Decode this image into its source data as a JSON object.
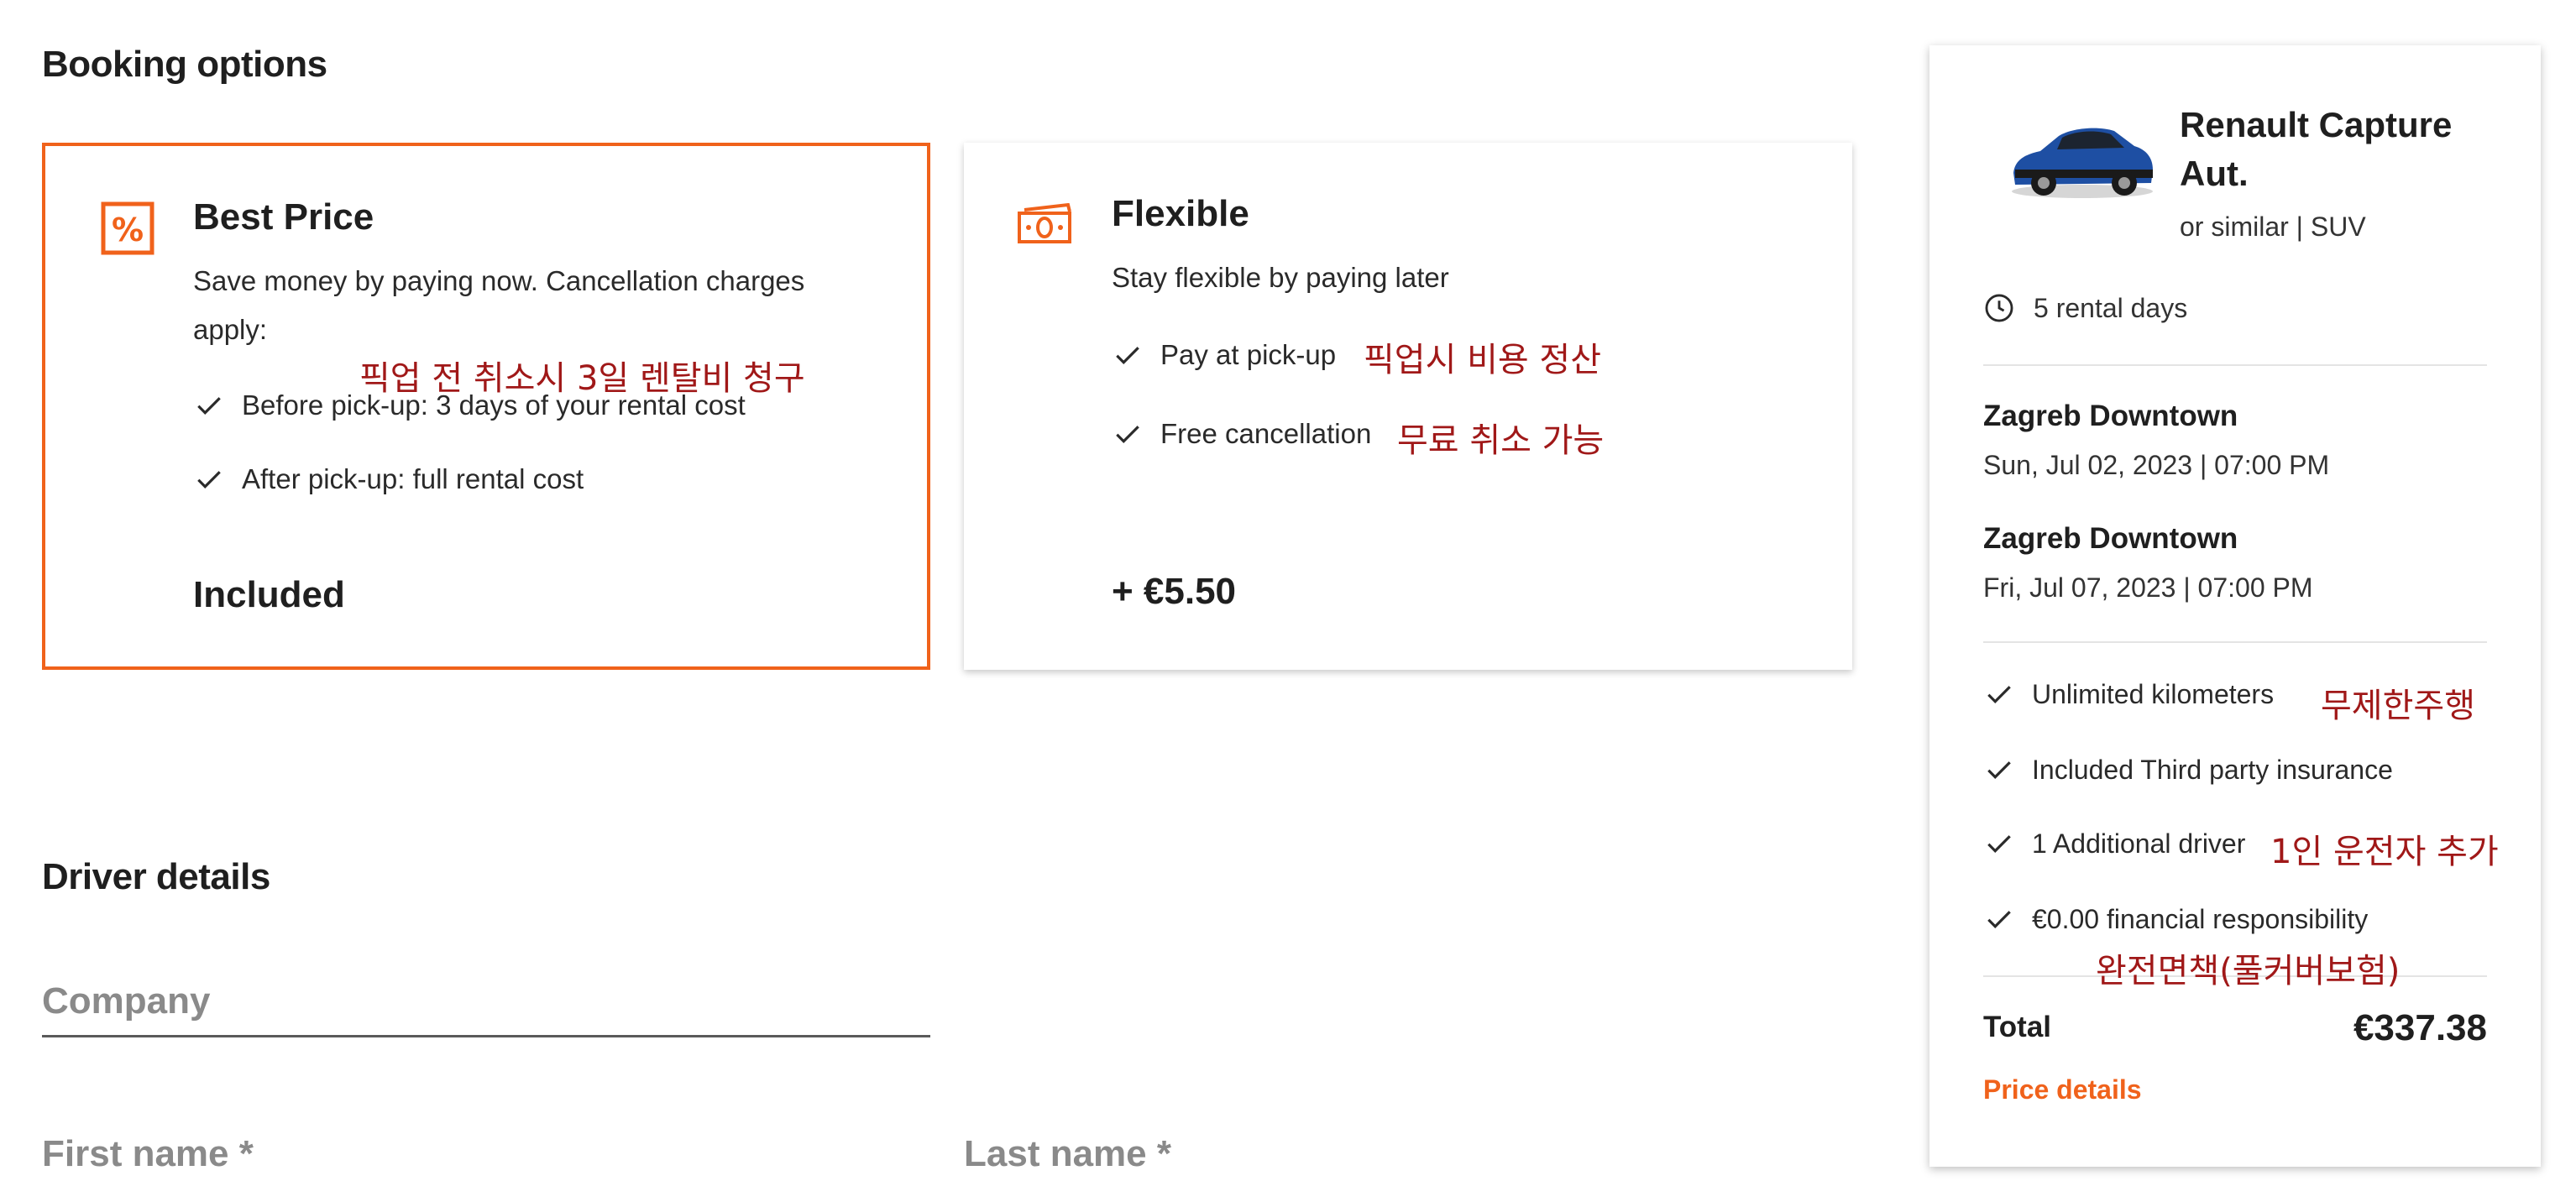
{
  "booking": {
    "heading": "Booking options",
    "best_price": {
      "title": "Best Price",
      "desc": "Save money by paying now. Cancellation charges apply:",
      "items": [
        "Before pick-up: 3 days of your rental cost",
        "After pick-up: full rental cost"
      ],
      "price": "Included",
      "icon": "percent-icon",
      "annotation": "픽업 전 취소시 3일 렌탈비 청구"
    },
    "flexible": {
      "title": "Flexible",
      "desc": "Stay flexible by paying later",
      "items": [
        "Pay at pick-up",
        "Free cancellation"
      ],
      "price": "+ €5.50",
      "icon": "cash-icon",
      "annotations": [
        "픽업시 비용 정산",
        "무료 취소 가능"
      ]
    }
  },
  "driver": {
    "heading": "Driver details",
    "company_label": "Company",
    "first_name_label": "First name *",
    "last_name_label": "Last name *"
  },
  "summary": {
    "car_name_line1": "Renault Capture",
    "car_name_line2": "Aut.",
    "car_sub": "or similar | SUV",
    "rental_days": "5 rental days",
    "pickup": {
      "location": "Zagreb Downtown",
      "datetime": "Sun, Jul 02, 2023 | 07:00 PM"
    },
    "dropoff": {
      "location": "Zagreb Downtown",
      "datetime": "Fri, Jul 07, 2023 | 07:00 PM"
    },
    "features": [
      "Unlimited kilometers",
      "Included Third party insurance",
      "1 Additional driver",
      "€0.00 financial responsibility"
    ],
    "feature_annotations": [
      "무제한주행",
      "1인 운전자 추가",
      "완전면책(풀커버보험)"
    ],
    "total_label": "Total",
    "total_value": "€337.38",
    "price_details_link": "Price details"
  },
  "colors": {
    "accent": "#f0621b",
    "annotation": "#a01818",
    "car_body": "#1e4fa3"
  }
}
